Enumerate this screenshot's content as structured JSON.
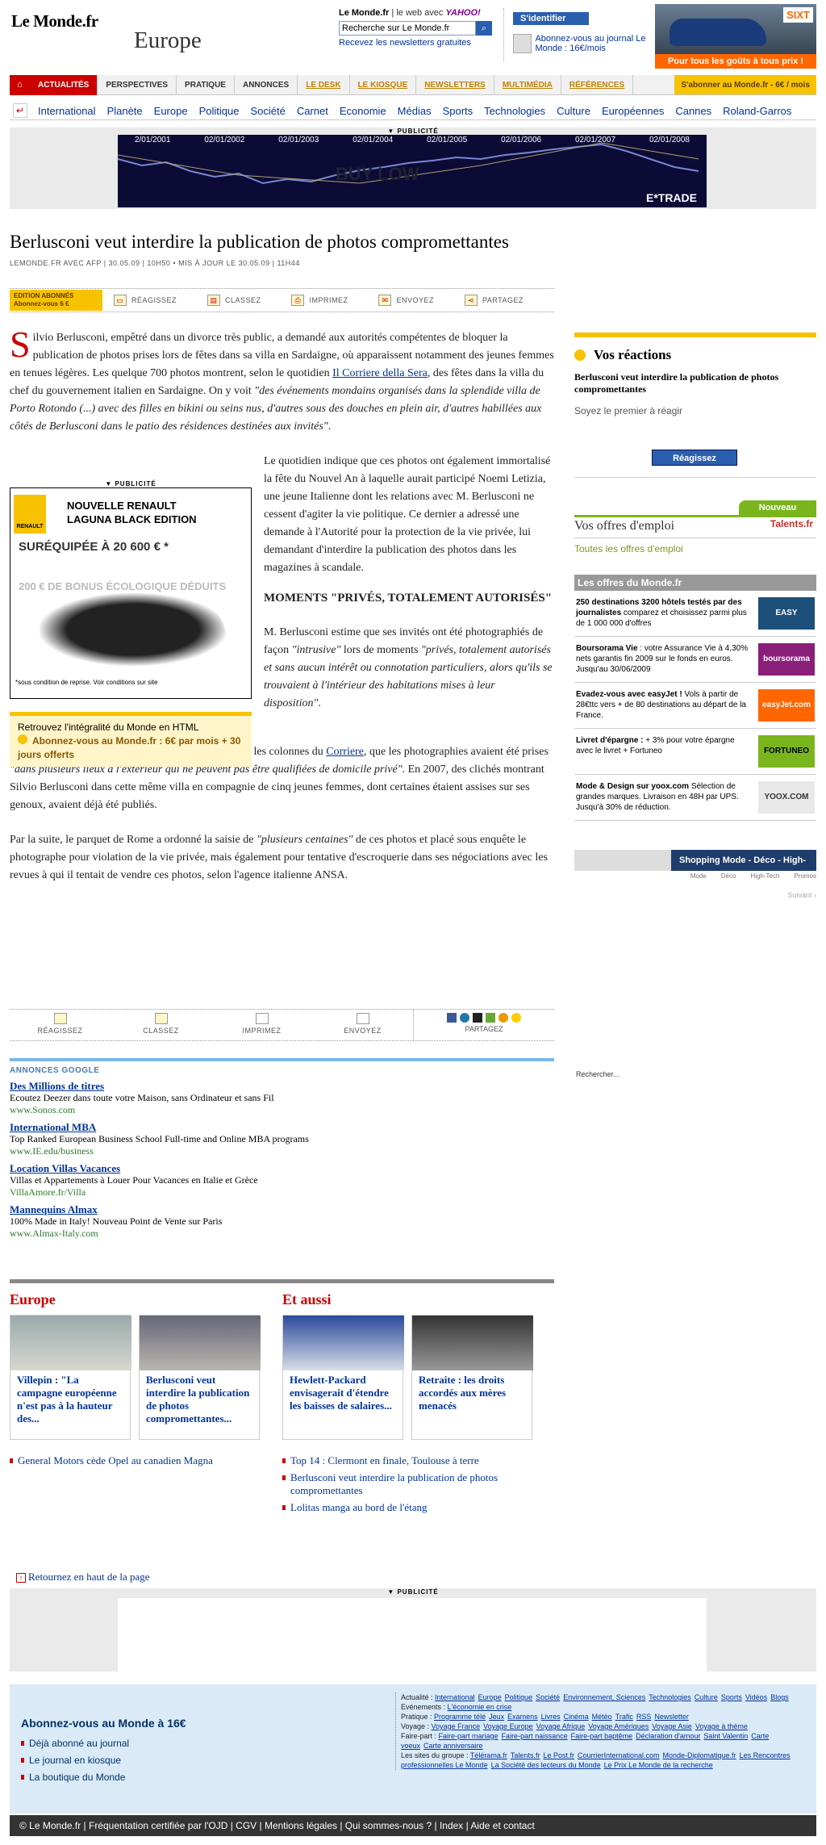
{
  "header": {
    "logo": "Le Monde.fr",
    "section": "Europe",
    "search_prefix": "Le Monde.fr",
    "search_sep": "| le web avec",
    "search_engine": "YAHOO!",
    "search_placeholder": "Recherche sur Le Monde.fr",
    "newsletter_link": "Recevez les newsletters gratuites",
    "identify_button": "S'identifier",
    "subscribe_text": "Abonnez-vous au journal Le Monde : 16€/mois",
    "ad": {
      "brand": "SIXT",
      "tagline": "Pour tous les goûts à tous prix !"
    }
  },
  "nav": {
    "home_icon": "home-icon",
    "tabs": [
      "ACTUALITÉS",
      "PERSPECTIVES",
      "PRATIQUE",
      "ANNONCES",
      "LE DESK",
      "LE KIOSQUE",
      "NEWSLETTERS",
      "MULTIMÉDIA",
      "RÉFÉRENCES"
    ],
    "subscribe": "S'abonner au Monde.fr - 6€ / mois",
    "sub_links": [
      "International",
      "Planète",
      "Europe",
      "Politique",
      "Société",
      "Carnet",
      "Economie",
      "Médias",
      "Sports",
      "Technologies",
      "Culture",
      "Européennes",
      "Cannes",
      "Roland-Garros"
    ]
  },
  "pub_label": "▼ PUBLICITÉ",
  "banner": {
    "dates": [
      "2/01/2001",
      "02/01/2002",
      "02/01/2003",
      "02/01/2004",
      "02/01/2005",
      "02/01/2006",
      "02/01/2007",
      "02/01/2008"
    ],
    "overlay": "BUY LOW",
    "brand": "E*TRADE"
  },
  "article": {
    "title": "Berlusconi veut interdire la publication de photos compromettantes",
    "byline": "LEMONDE.FR avec AFP | 30.05.09 | 10h50  •  Mis à jour le 30.05.09 | 11h44",
    "edition_badge": "EDITION ABONNÉS Abonnez-vous 6 €",
    "tools": [
      "RÉAGISSEZ",
      "CLASSEZ",
      "IMPRIMEZ",
      "ENVOYEZ",
      "PARTAGEZ"
    ],
    "p1_dropcap": "S",
    "p1_a": "ilvio Berlusconi, empêtré dans un divorce très public, a demandé aux autorités compétentes de bloquer la publication de photos prises lors de fêtes dans sa villa en Sardaigne, où apparaissent notamment des jeunes femmes en tenues légères. Les quelque 700 photos montrent, selon le quotidien ",
    "p1_link": "Il Corriere della Sera",
    "p1_b": ", des fêtes dans la villa du chef du gouvernement italien en Sardaigne. On y voit ",
    "p1_quote": "\"des événements mondains organisés dans la splendide villa de Porto Rotondo (...) avec des filles en bikini ou seins nus, d'autres sous des douches en plein air, d'autres habillées aux côtés de Berlusconi dans le patio des résidences destinées aux invités\"",
    "p1_end": ".",
    "p2": "Le quotidien indique que ces photos ont également immortalisé la fête du Nouvel An à laquelle aurait participé Noemi Letizia, une jeune Italienne dont les relations avec M. Berlusconi ne cessent d'agiter la vie politique. Ce dernier a adressé une demande à l'Autorité pour la protection de la vie privée, lui demandant d'interdire la publication des photos dans les magazines à scandale.",
    "h2": "MOMENTS \"PRIVÉS, TOTALEMENT AUTORISÉS\"",
    "p3_a": "M. Berlusconi estime que ses invités ont été photographiés de façon ",
    "p3_q1": "\"intrusive\"",
    "p3_b": " lors de moments ",
    "p3_q2": "\"privés, totalement autorisés et sans aucun intérêt ou connotation particuliers, alors qu'ils se trouvaient à l'intérieur des habitations mises à leur disposition\"",
    "p3_end": ".",
    "p4_a": "Le photographe, Antonello Zappadu, a rétorqué, dans les colonnes du ",
    "p4_link": "Corriere",
    "p4_b": ", que les photographies avaient été prises ",
    "p4_q": "\"dans plusieurs lieux à l'extérieur qui ne peuvent pas être qualifiées de domicile privé\"",
    "p4_c": ". En 2007, des clichés montrant Silvio Berlusconi dans cette même villa en compagnie de cinq jeunes femmes, dont certaines étaient assises sur ses genoux, avaient déjà été publiés.",
    "p5_a": "Par la suite, le parquet de Rome a ordonné la saisie de ",
    "p5_q": "\"plusieurs centaines\"",
    "p5_b": " de ces photos et placé sous enquête le photographe pour violation de la vie privée, mais également pour tentative d'escroquerie dans ses négociations avec les revues à qui il tentait de vendre ces photos, selon l'agence italienne ANSA."
  },
  "inline_ad": {
    "l1": "NOUVELLE RENAULT",
    "l2": "LAGUNA BLACK EDITION",
    "l3": "SURÉQUIPÉE À 20 600 € *",
    "l4": "200 € DE BONUS ÉCOLOGIQUE DÉDUITS",
    "l5": "*sous condition de reprise. Voir conditions sur site",
    "brand": "RENAULT"
  },
  "abonne_box": {
    "line1": "Retrouvez l'intégralité du Monde en HTML",
    "line2": "Abonnez-vous au Monde.fr : 6€ par mois + 30 jours offerts"
  },
  "bottom_tools": [
    "RÉAGISSEZ",
    "CLASSEZ",
    "IMPRIMEZ",
    "ENVOYEZ",
    "PARTAGEZ"
  ],
  "google_ads": {
    "title": "ANNONCES GOOGLE",
    "items": [
      {
        "t": "Des Millions de titres",
        "d": "Ecoutez Deezer dans toute votre Maison, sans Ordinateur et sans Fil",
        "u": "www.Sonos.com"
      },
      {
        "t": "International MBA",
        "d": "Top Ranked European Business School Full-time and Online MBA programs",
        "u": "www.IE.edu/business"
      },
      {
        "t": "Location Villas Vacances",
        "d": "Villas et Appartements à Louer Pour Vacances en Italie et Grèce",
        "u": "VillaAmore.fr/Villa"
      },
      {
        "t": "Mannequins Almax",
        "d": "100% Made in Italy! Nouveau Point de Vente sur Paris",
        "u": "www.Almax-Italy.com"
      }
    ]
  },
  "lower": {
    "europe_title": "Europe",
    "europe_cards": [
      "Villepin : \"La campagne européenne n'est pas à la hauteur des...",
      "Berlusconi veut interdire la publication de photos compromettantes..."
    ],
    "europe_links": [
      "General Motors cède Opel au canadien Magna"
    ],
    "aussi_title": "Et aussi",
    "aussi_cards": [
      "Hewlett-Packard envisagerait d'étendre les baisses de salaires...",
      "Retraite : les droits accordés aux mères menacés"
    ],
    "aussi_links": [
      "Top 14 : Clermont en finale, Toulouse à terre",
      "Berlusconi veut interdire la publication de photos compromettantes",
      "Lolitas manga au bord de l'étang"
    ]
  },
  "back_top": "Retournez en haut de la page",
  "sidebar": {
    "reactions_title": "Vos réactions",
    "reactions_subject": "Berlusconi veut interdire la publication de photos compromettantes",
    "reactions_first": "Soyez le premier à réagir",
    "react_button": "Réagissez",
    "emploi_badge": "Nouveau",
    "emploi_title": "Vos offres d'emploi",
    "emploi_brand": "Talents.fr",
    "emploi_link": "Toutes les offres d'emploi",
    "offres_title": "Les offres du Monde.fr",
    "offres": [
      {
        "b": "250 destinations 3200 hôtels testés par des journalistes",
        "t": "comparez et choisissez parmi plus de 1 000 000 d'offres",
        "logo": "EASY VOYAGE",
        "color": "#1c4f7a"
      },
      {
        "b": "Boursorama Vie",
        "t": ": votre Assurance Vie à 4,30% nets garantis fin 2009 sur le fonds en euros. Jusqu'au 30/06/2009",
        "logo": "boursorama banque",
        "color": "#8a1f7a"
      },
      {
        "b": "Evadez-vous avec easyJet !",
        "t": "Vols à partir de 28€ttc vers + de 80 destinations au départ de la France.",
        "logo": "easyJet.com",
        "color": "#f60"
      },
      {
        "b": "Livret d'épargne :",
        "t": "+ 3% pour votre épargne avec le livret + Fortuneo",
        "logo": "FORTUNEO",
        "color": "#7ab51d"
      },
      {
        "b": "Mode & Design sur yoox.com",
        "t": "Sélection de grandes marques. Livraison en 48H par UPS. Jusqu'à 30% de réduction.",
        "logo": "YOOX.COM",
        "color": "#ccc"
      }
    ],
    "shop_title": "Shopping Mode - Déco - High-tech",
    "shop_tabs": [
      "Mode",
      "Déco",
      "High-Tech",
      "Promos"
    ],
    "shop_next": "Suivant ›",
    "search_stub": "Rechercher..."
  },
  "footer": {
    "subscribe_title": "Abonnez-vous au Monde à 16€",
    "links": [
      "Déjà abonné au journal",
      "Le journal en kiosque",
      "La boutique du Monde"
    ],
    "sitemap_actualite_label": "Actualité :",
    "sitemap_actualite": [
      "International",
      "Europe",
      "Politique",
      "Société",
      "Environnement, Sciences",
      "Technologies",
      "Culture",
      "Sports",
      "Vidéos",
      "Blogs"
    ],
    "sitemap_events_label": "Evénements :",
    "sitemap_events": [
      "L'économie en crise"
    ],
    "sitemap_pratique_label": "Pratique :",
    "sitemap_pratique": [
      "Programme télé",
      "Jeux",
      "Examens",
      "Livres",
      "Cinéma",
      "Météo",
      "Trafic",
      "RSS",
      "Newsletter"
    ],
    "sitemap_voyage_label": "Voyage :",
    "sitemap_voyage": [
      "Voyage France",
      "Voyage Europe",
      "Voyage Afrique",
      "Voyage Amériques",
      "Voyage Asie",
      "Voyage à thème"
    ],
    "sitemap_fairepart_label": "Faire-part :",
    "sitemap_fairepart": [
      "Faire-part mariage",
      "Faire-part naissance",
      "Faire-part baptême",
      "Déclaration d'amour",
      "Saint Valentin",
      "Carte voeux",
      "Carte anniversaire"
    ],
    "sitemap_groupe_label": "Les sites du groupe :",
    "sitemap_groupe": [
      "Télérama.fr",
      "Talents.fr",
      "Le Post.fr",
      "CourrierInternational.com",
      "Monde-Diplomatique.fr",
      "Les Rencontres professionnelles Le Monde",
      "La Société des lecteurs du Monde",
      "Le Prix Le Monde de la recherche"
    ],
    "bar": "© Le Monde.fr | Fréquentation certifiée par l'OJD | CGV | Mentions légales | Qui sommes-nous ? | Index | Aide et contact"
  },
  "colors": {
    "brand_red": "#cc0000",
    "gold": "#f7c200",
    "link": "#003399"
  }
}
